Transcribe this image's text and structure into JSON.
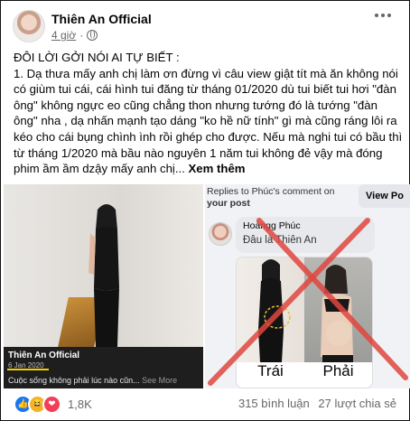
{
  "post": {
    "author": "Thiên An Official",
    "time": "4 giờ",
    "privacy_icon": "globe-icon",
    "text_heading": "ĐÔI LỜI GỞI NÓI AI TỰ BIẾT :",
    "text_body": "1. Dạ thưa mấy anh chị làm ơn đừng vì câu view giật tít mà ăn không nói có giùm tui cái, cái hình tui đăng từ tháng 01/2020 dù tui biết tui hơi \"đàn ông\" không ngực eo cũng chẳng thon nhưng tướng đó là tướng \"đàn ông\" nha , dạ nhấn mạnh tạo dáng \"ko hề nữ tính\" gì mà cũng ráng lôi ra kéo cho cái bụng chình ình rồi ghép cho được. Nếu mà nghi tui có bầu thì từ tháng 1/2020 mà bầu nào nguyên 1 năm tui không đẻ vậy mà đóng phim ầm ầm dzậy mấy anh chị...",
    "see_more": "Xem thêm"
  },
  "left_image": {
    "card_name": "Thiên An Official",
    "card_date": "6 Jan 2020",
    "card_caption": "Cuộc sống không phải lúc nào cũn...",
    "card_see_more": "See More"
  },
  "right_image": {
    "replies_text_1": "Replies to Phúc's comment on",
    "replies_text_2": "your post",
    "view_button": "View Po",
    "commenter": "Hoàngg Phúc",
    "comment": "Đâu là Thiên An",
    "label_left": "Trái",
    "label_right": "Phải",
    "cross_color": "#e0473f"
  },
  "footer": {
    "reaction_count": "1,8K",
    "comments": "315 bình luận",
    "shares": "27 lượt chia sẻ"
  }
}
